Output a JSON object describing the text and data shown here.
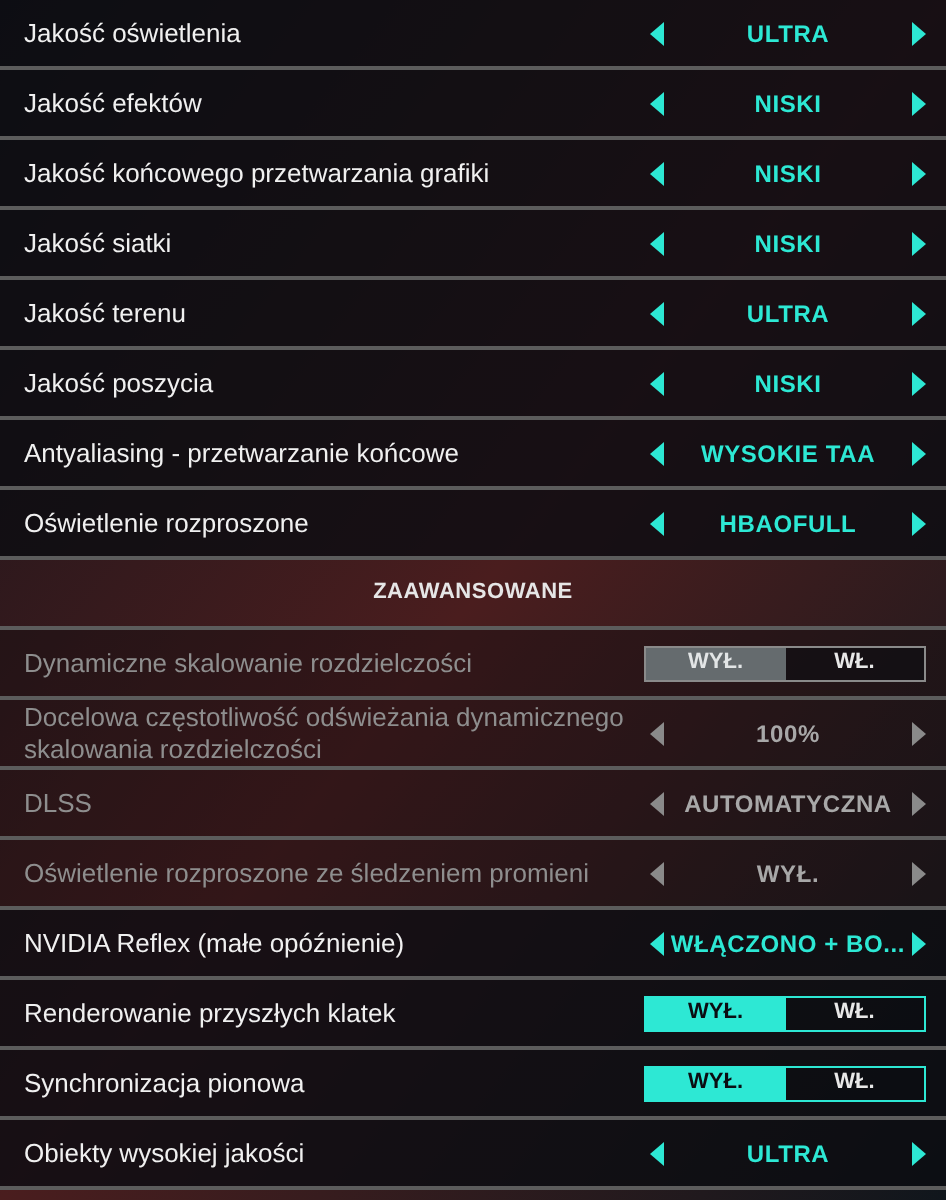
{
  "rows": [
    {
      "kind": "selector",
      "label": "Jakość oświetlenia",
      "value": "ULTRA",
      "disabled": false
    },
    {
      "kind": "selector",
      "label": "Jakość efektów",
      "value": "NISKI",
      "disabled": false
    },
    {
      "kind": "selector",
      "label": "Jakość końcowego przetwarzania grafiki",
      "value": "NISKI",
      "disabled": false
    },
    {
      "kind": "selector",
      "label": "Jakość siatki",
      "value": "NISKI",
      "disabled": false
    },
    {
      "kind": "selector",
      "label": "Jakość terenu",
      "value": "ULTRA",
      "disabled": false
    },
    {
      "kind": "selector",
      "label": "Jakość poszycia",
      "value": "NISKI",
      "disabled": false
    },
    {
      "kind": "selector",
      "label": "Antyaliasing - przetwarzanie końcowe",
      "value": "WYSOKIE TAA",
      "disabled": false
    },
    {
      "kind": "selector",
      "label": "Oświetlenie rozproszone",
      "value": "HBAOFULL",
      "disabled": false
    },
    {
      "kind": "header",
      "label": "ZAAWANSOWANE"
    },
    {
      "kind": "toggle",
      "label": "Dynamiczne skalowanie rozdzielczości",
      "disabled": true,
      "options": [
        {
          "label": "WYŁ.",
          "selected": true
        },
        {
          "label": "WŁ.",
          "selected": false
        }
      ]
    },
    {
      "kind": "selector",
      "label": "Docelowa częstotliwość odświeżania dynamicznego skalowania rozdzielczości",
      "value": "100%",
      "disabled": true
    },
    {
      "kind": "selector",
      "label": "DLSS",
      "value": "AUTOMATYCZNA",
      "disabled": true
    },
    {
      "kind": "selector",
      "label": "Oświetlenie rozproszone ze śledzeniem promieni",
      "value": "WYŁ.",
      "disabled": true
    },
    {
      "kind": "selector",
      "label": "NVIDIA Reflex (małe opóźnienie)",
      "value": "WŁĄCZONO + BO...",
      "disabled": false
    },
    {
      "kind": "toggle",
      "label": "Renderowanie przyszłych klatek",
      "disabled": false,
      "options": [
        {
          "label": "WYŁ.",
          "selected": true
        },
        {
          "label": "WŁ.",
          "selected": false
        }
      ]
    },
    {
      "kind": "toggle",
      "label": "Synchronizacja pionowa",
      "disabled": false,
      "options": [
        {
          "label": "WYŁ.",
          "selected": true
        },
        {
          "label": "WŁ.",
          "selected": false
        }
      ]
    },
    {
      "kind": "selector",
      "label": "Obiekty wysokiej jakości",
      "value": "ULTRA",
      "disabled": false
    }
  ]
}
